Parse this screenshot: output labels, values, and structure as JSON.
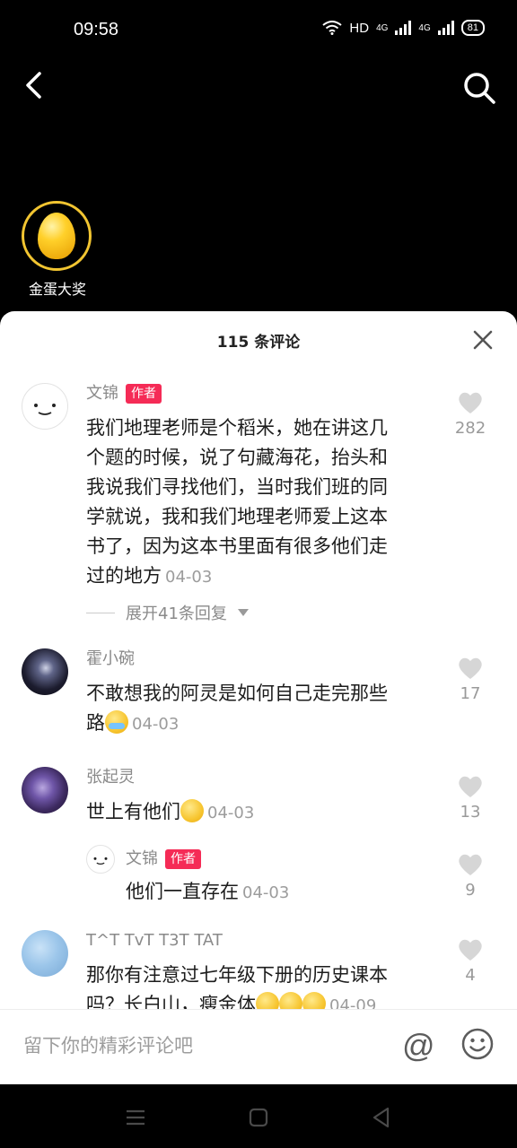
{
  "status_bar": {
    "time": "09:58",
    "hd_label": "HD",
    "net_1": "4G",
    "net_2": "4G",
    "battery": "81"
  },
  "top_nav": {
    "back_icon": "chevron-left-icon",
    "search_icon": "search-icon"
  },
  "promo": {
    "label": "金蛋大奖"
  },
  "sheet": {
    "title": "115 条评论",
    "close_icon": "close-icon"
  },
  "comments": [
    {
      "author": "文锦",
      "tag": "作者",
      "text": "我们地理老师是个稻米，她在讲这几个题的时候，说了句藏海花，抬头和我说我们寻找他们，当时我们班的同学就说，我和我们地理老师爱上这本书了，因为这本书里面有很多他们走过的地方",
      "date": "04-03",
      "likes": "282",
      "expand_label": "展开41条回复"
    },
    {
      "author": "霍小碗",
      "text": "不敢想我的阿灵是如何自己走完那些路",
      "date": "04-03",
      "likes": "17"
    },
    {
      "author": "张起灵",
      "text": "世上有他们",
      "date": "04-03",
      "likes": "13"
    },
    {
      "author": "文锦",
      "tag": "作者",
      "text": "他们一直存在",
      "date": "04-03",
      "likes": "9"
    },
    {
      "author": "T^T TvT T3T TAT",
      "text": "那你有注意过七年级下册的历史课本吗？长白山，瘦金体",
      "date": "04-09",
      "likes": "4"
    }
  ],
  "input_bar": {
    "placeholder": "留下你的精彩评论吧",
    "at_label": "@"
  }
}
